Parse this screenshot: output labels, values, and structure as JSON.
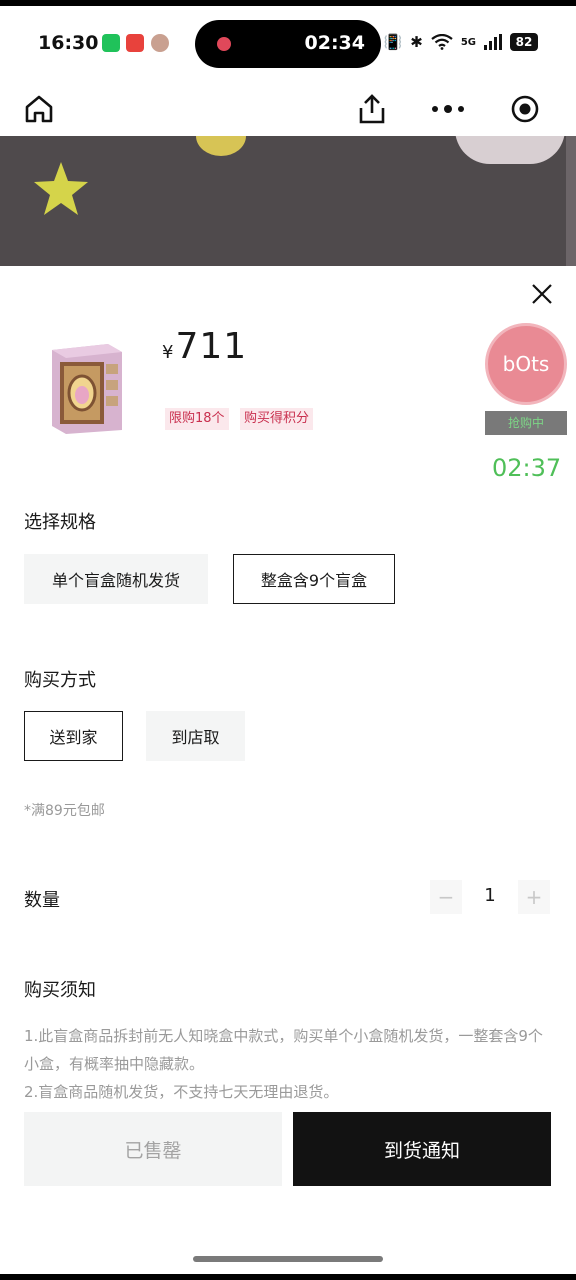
{
  "status_bar": {
    "time": "16:30",
    "recording_time": "02:34",
    "network": "5G",
    "battery": "82"
  },
  "navbar": {
    "icons": [
      "home-icon",
      "share-icon",
      "more-icon",
      "target-icon"
    ]
  },
  "product": {
    "currency": "¥",
    "price": "711",
    "tags": [
      "限购18个",
      "购买得积分"
    ]
  },
  "overlay": {
    "bots_label": "bOts",
    "bots_status": "抢购中",
    "timer": "02:37"
  },
  "spec": {
    "title": "选择规格",
    "options": [
      "单个盲盒随机发货",
      "整盒含9个盲盒"
    ],
    "selected": 1
  },
  "purchase_method": {
    "title": "购买方式",
    "options": [
      "送到家",
      "到店取"
    ],
    "selected": 0,
    "note": "*满89元包邮"
  },
  "quantity": {
    "title": "数量",
    "value": "1",
    "minus": "−",
    "plus": "+"
  },
  "notice": {
    "title": "购买须知",
    "lines": [
      "1.此盲盒商品拆封前无人知晓盒中款式，购买单个小盒随机发货，一整套含9个小盒，有概率抽中隐藏款。",
      "2.盲盒商品随机发货，不支持七天无理由退货。"
    ]
  },
  "actions": {
    "sold_out": "已售罄",
    "notify": "到货通知"
  },
  "colors": {
    "accent_green": "#4fbf58",
    "tag_pink": "#c9304f",
    "primary_dark": "#121212"
  }
}
